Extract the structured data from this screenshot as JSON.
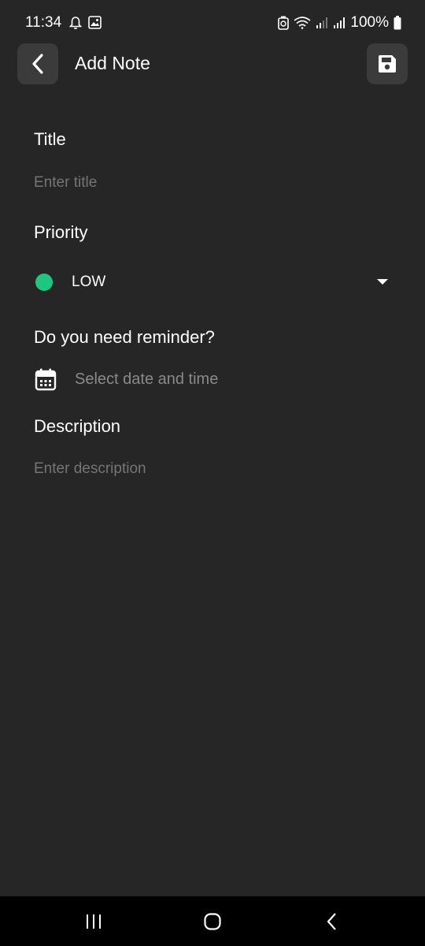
{
  "status_bar": {
    "time": "11:34",
    "battery": "100%"
  },
  "header": {
    "title": "Add Note"
  },
  "form": {
    "title_label": "Title",
    "title_placeholder": "Enter title",
    "priority_label": "Priority",
    "priority_value": "LOW",
    "priority_color": "#1ec780",
    "reminder_label": "Do you need reminder?",
    "reminder_placeholder": "Select date and time",
    "description_label": "Description",
    "description_placeholder": "Enter description"
  },
  "icons": {
    "back": "chevron-left-icon",
    "save": "floppy-disk-icon",
    "calendar": "calendar-icon",
    "dropdown": "caret-down-icon"
  },
  "colors": {
    "background": "#262626",
    "button_background": "#3b3b3b",
    "placeholder": "#8a8a8a"
  }
}
